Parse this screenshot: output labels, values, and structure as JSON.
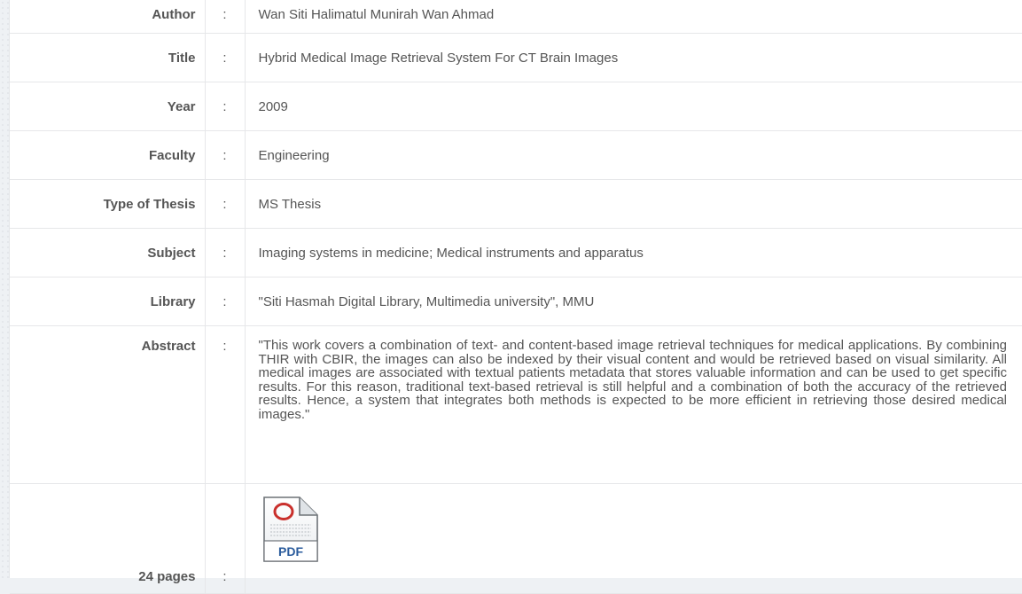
{
  "record": {
    "author": {
      "label": "Author",
      "value": "Wan Siti Halimatul Munirah Wan Ahmad"
    },
    "title": {
      "label": "Title",
      "value": "Hybrid Medical Image Retrieval System For CT Brain Images"
    },
    "year": {
      "label": "Year",
      "value": "2009"
    },
    "faculty": {
      "label": "Faculty",
      "value": "Engineering"
    },
    "type": {
      "label": "Type of Thesis",
      "value": "MS Thesis"
    },
    "subject": {
      "label": "Subject",
      "value": "Imaging systems in medicine; Medical instruments and apparatus"
    },
    "library": {
      "label": "Library",
      "value": "\"Siti Hasmah Digital Library, Multimedia university\", MMU"
    },
    "abstract": {
      "label": "Abstract",
      "value": "\"This work covers a combination of text- and content-based image retrieval techniques for medical applications. By combining THIR with CBIR, the images can also be indexed by their visual content and would be retrieved based on visual similarity. All medical images are associated with textual patients metadata that stores valuable information and can be used to get specific results. For this reason, traditional text-based retrieval is still helpful and a combination of both the accuracy of the retrieved results. Hence, a system that integrates both methods is expected to be more efficient in retrieving those desired medical images.\""
    },
    "pages": {
      "label": "24 pages",
      "icon": "pdf-file-icon",
      "icon_text": "PDF"
    }
  },
  "separator": ":",
  "colors": {
    "pdf_red": "#c9302c",
    "pdf_blue": "#2a5b9c"
  }
}
